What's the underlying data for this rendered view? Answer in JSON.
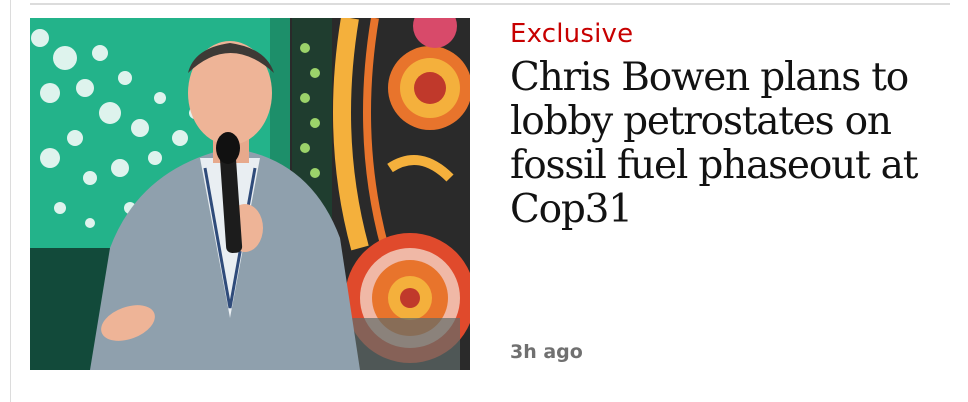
{
  "article": {
    "kicker": "Exclusive",
    "headline": "Chris Bowen plans to lobby petrostates on fossil fuel phaseout at Cop31",
    "timestamp": "3h ago",
    "image_subject": "man in grey blazer speaking into a microphone before a green backdrop and Indigenous artwork"
  },
  "colors": {
    "kicker": "#c70000",
    "headline": "#121212",
    "timestamp": "#707070",
    "rule": "#dcdcdc"
  }
}
